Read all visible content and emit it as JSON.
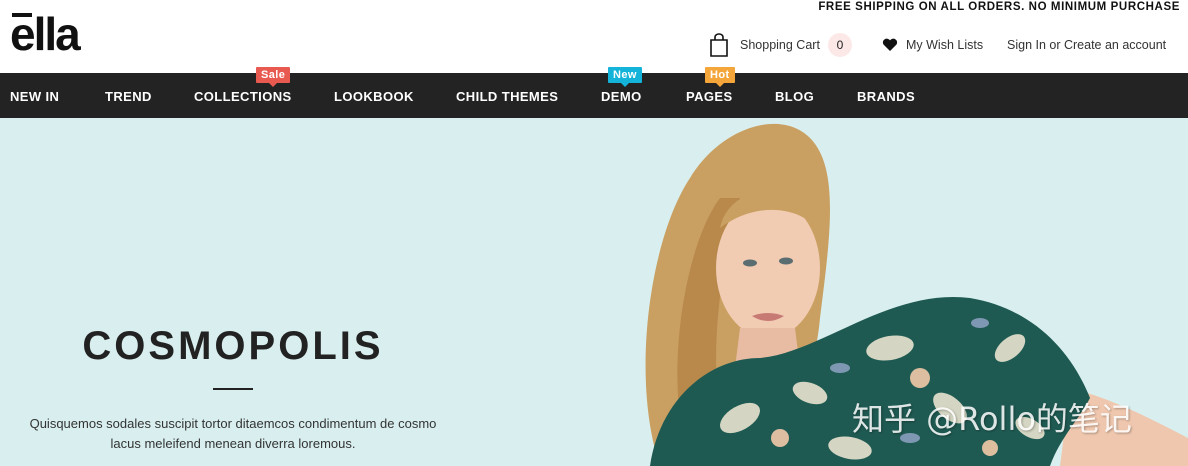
{
  "header": {
    "promo": "FREE SHIPPING ON ALL ORDERS. NO MINIMUM PURCHASE",
    "logo": "ella",
    "cart_label": "Shopping Cart",
    "cart_count": "0",
    "wishlist_label": "My Wish Lists",
    "account_label": "Sign In or Create an account"
  },
  "nav": {
    "items": [
      {
        "label": "NEW IN"
      },
      {
        "label": "TREND"
      },
      {
        "label": "COLLECTIONS",
        "badge": "Sale"
      },
      {
        "label": "LOOKBOOK"
      },
      {
        "label": "CHILD THEMES"
      },
      {
        "label": "DEMO",
        "badge": "New"
      },
      {
        "label": "PAGES",
        "badge": "Hot"
      },
      {
        "label": "BLOG"
      },
      {
        "label": "BRANDS"
      }
    ]
  },
  "hero": {
    "title": "COSMOPOLIS",
    "text": "Quisquemos sodales suscipit tortor ditaemcos condimentum de cosmo lacus meleifend menean diverra loremous.",
    "watermark": "知乎 @Rollo的笔记"
  },
  "colors": {
    "nav_bg": "#232323",
    "hero_bg": "#d9efef",
    "badge_sale": "#e85a4f",
    "badge_new": "#14b3d9",
    "badge_hot": "#f4a63a"
  },
  "icons": [
    "shopping-bag-icon",
    "heart-icon"
  ]
}
